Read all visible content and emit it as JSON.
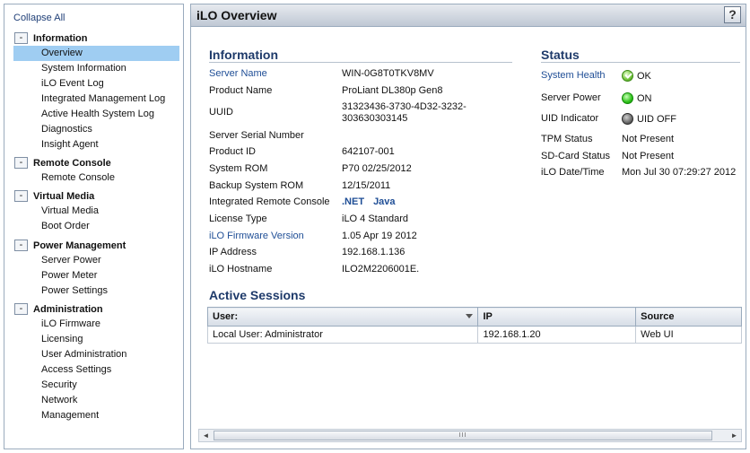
{
  "sidebar": {
    "collapse_all": "Collapse All",
    "toggle_symbol": "-",
    "sections": [
      {
        "title": "Information",
        "items": [
          "Overview",
          "System Information",
          "iLO Event Log",
          "Integrated Management Log",
          "Active Health System Log",
          "Diagnostics",
          "Insight Agent"
        ]
      },
      {
        "title": "Remote Console",
        "items": [
          "Remote Console"
        ]
      },
      {
        "title": "Virtual Media",
        "items": [
          "Virtual Media",
          "Boot Order"
        ]
      },
      {
        "title": "Power Management",
        "items": [
          "Server Power",
          "Power Meter",
          "Power Settings"
        ]
      },
      {
        "title": "Administration",
        "items": [
          "iLO Firmware",
          "Licensing",
          "User Administration",
          "Access Settings",
          "Security",
          "Network",
          "Management"
        ]
      }
    ],
    "selected_item": "Overview"
  },
  "header": {
    "title": "iLO Overview",
    "help_label": "?"
  },
  "information": {
    "title": "Information",
    "rows": [
      {
        "label": "Server Name",
        "value": "WIN-0G8T0TKV8MV",
        "label_is_link": true
      },
      {
        "label": "Product Name",
        "value": "ProLiant DL380p Gen8"
      },
      {
        "label": "UUID",
        "value": "31323436-3730-4D32-3232-303630303145"
      },
      {
        "label": "Server Serial Number",
        "value": ""
      },
      {
        "label": "Product ID",
        "value": "642107-001"
      },
      {
        "label": "System ROM",
        "value": "P70 02/25/2012"
      },
      {
        "label": "Backup System ROM",
        "value": "12/15/2011"
      },
      {
        "label": "Integrated Remote Console",
        "links": [
          ".NET",
          "Java"
        ]
      },
      {
        "label": "License Type",
        "value": "iLO 4 Standard"
      },
      {
        "label": "iLO Firmware Version",
        "value": "1.05 Apr 19 2012",
        "label_is_link": true
      },
      {
        "label": "IP Address",
        "value": "192.168.1.136"
      },
      {
        "label": "iLO Hostname",
        "value": "ILO2M2206001E."
      }
    ]
  },
  "status": {
    "title": "Status",
    "rows": [
      {
        "label": "System Health",
        "value": "OK",
        "icon": "ok-check-icon",
        "label_is_link": true
      },
      {
        "label": "Server Power",
        "value": "ON",
        "icon": "green-led-icon"
      },
      {
        "label": "UID Indicator",
        "value": "UID OFF",
        "icon": "gray-led-icon"
      },
      {
        "label": "TPM Status",
        "value": "Not Present"
      },
      {
        "label": "SD-Card Status",
        "value": "Not Present"
      },
      {
        "label": "iLO Date/Time",
        "value": "Mon Jul 30 07:29:27 2012"
      }
    ]
  },
  "sessions": {
    "title": "Active Sessions",
    "columns": [
      "User:",
      "IP",
      "Source"
    ],
    "rows": [
      [
        "Local User: Administrator",
        "192.168.1.20",
        "Web UI"
      ]
    ]
  },
  "scrollbar": {
    "left_arrow": "◄",
    "right_arrow": "►",
    "grip": "III"
  }
}
